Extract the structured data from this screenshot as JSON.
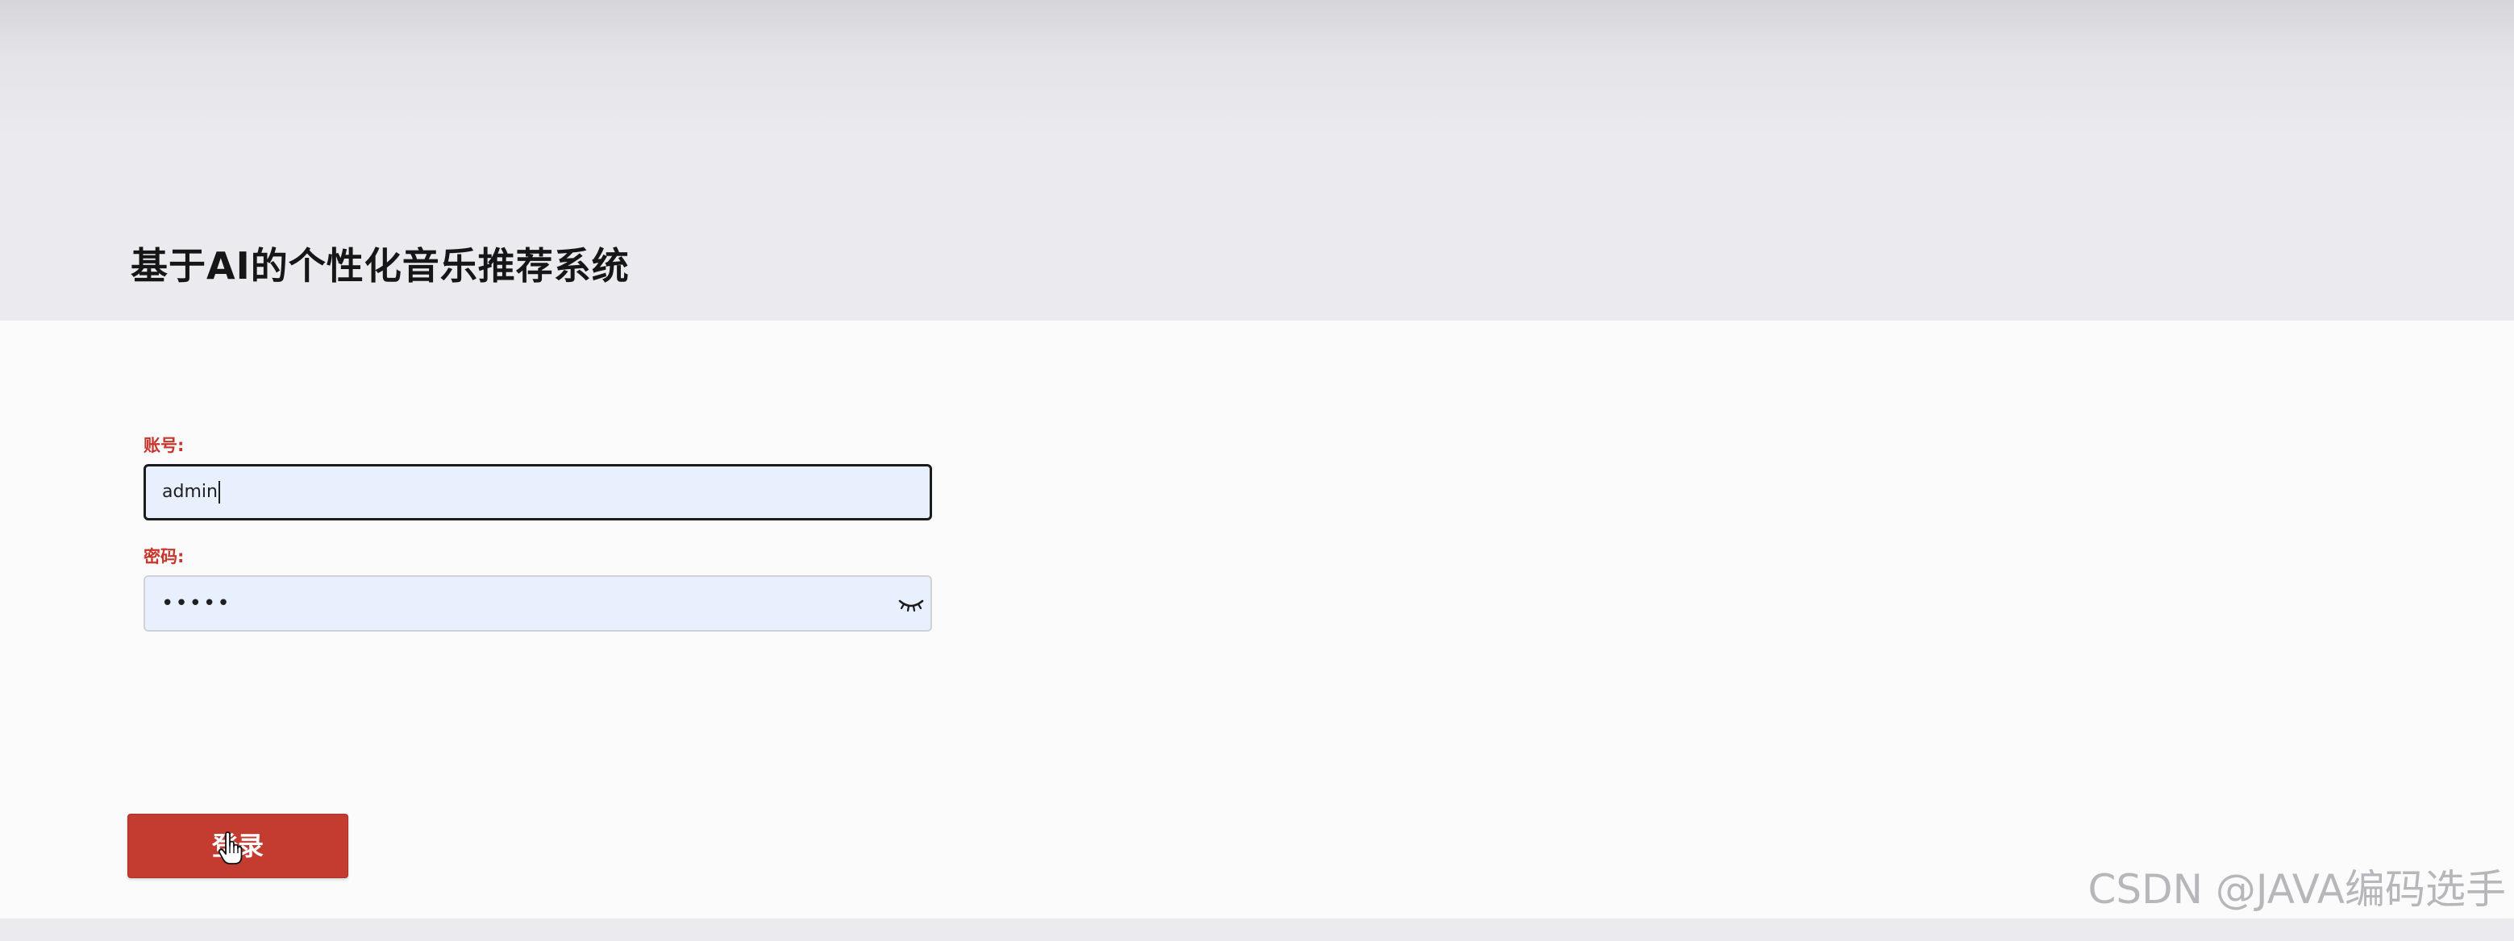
{
  "header": {
    "title": "基于AI的个性化音乐推荐系统"
  },
  "form": {
    "username": {
      "label": "账号:",
      "value": "admin"
    },
    "password": {
      "label": "密码:",
      "masked_value": "•••••",
      "toggle_icon": "eye-closed-icon"
    },
    "login_label": "登录"
  },
  "cursor_icon": "hand-pointer-icon",
  "watermark": "CSDN @JAVA编码选手",
  "colors": {
    "accent": "#c43c2f",
    "label": "#c8352b",
    "header_bg": "#ebebef",
    "input_bg": "#e8f0fe"
  }
}
